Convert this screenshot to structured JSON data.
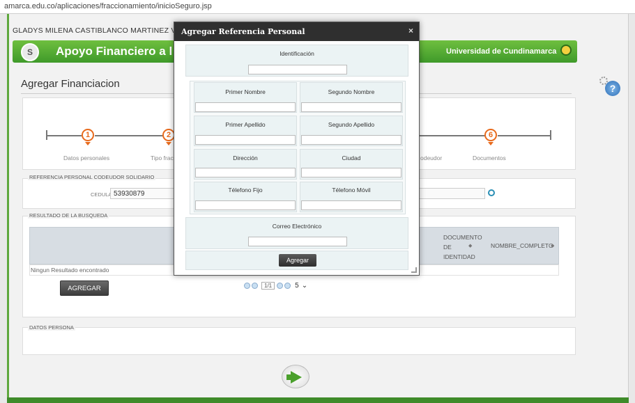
{
  "browser": {
    "url": "amarca.edu.co/aplicaciones/fraccionamiento/inicioSeguro.jsp"
  },
  "header": {
    "user_name": "GLADYS MILENA CASTIBLANCO MARTINEZ V.",
    "app_title": "Apoyo Financiero a l",
    "university": "Universidad de Cundinamarca",
    "logo_text": "S"
  },
  "help": {
    "label": "?"
  },
  "page": {
    "title": "Agregar Financiacion"
  },
  "steps": [
    {
      "number": "1",
      "label": "Datos personales"
    },
    {
      "number": "2",
      "label": "Tipo fracciona"
    },
    {
      "number": "",
      "label": "odeudor"
    },
    {
      "number": "6",
      "label": "Documentos"
    }
  ],
  "reference": {
    "section_title": "REFERENCIA PERSONAL CODEUDOR SOLIDARIO",
    "cedula_label": "CEDULA",
    "cedula_value": "53930879"
  },
  "results": {
    "section_title": "RESULTADO DE LA BUSQUEDA",
    "columns": [
      "DOCUMENTO DE IDENTIDAD",
      "NOMBRE_COMPLETO"
    ],
    "col_doc_line1": "DOCUMENTO",
    "col_doc_line2": "DE",
    "col_doc_line3": "IDENTIDAD",
    "col_name": "NOMBRE_COMPLETO",
    "sort_icon": "◆",
    "no_result": "Ningun Resultado encontrado",
    "add_button": "AGREGAR",
    "pager_current": "1/1",
    "page_size": "5"
  },
  "persona": {
    "section_title": "DATOS PERSONA"
  },
  "modal": {
    "title": "Agregar Referencia Personal",
    "close": "×",
    "fields": {
      "identificacion": "Identificación",
      "primer_nombre": "Primer Nombre",
      "segundo_nombre": "Segundo Nombre",
      "primer_apellido": "Primer Apellido",
      "segundo_apellido": "Segundo Apellido",
      "direccion": "Dirección",
      "ciudad": "Ciudad",
      "telefono_fijo": "Télefono Fijo",
      "telefono_movil": "Télefono Móvil",
      "correo": "Correo Electrónico"
    },
    "add_button": "Agregar"
  },
  "colors": {
    "brand_green": "#4aa02c",
    "step_orange": "#e86a1c",
    "modal_header": "#2f2f2f"
  }
}
